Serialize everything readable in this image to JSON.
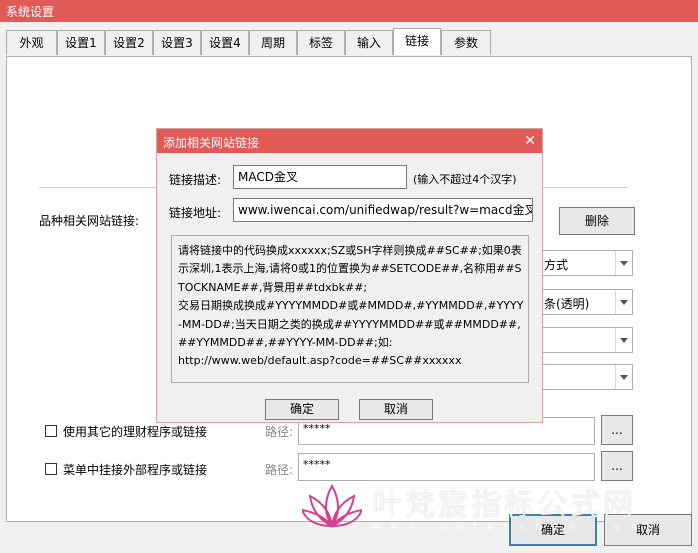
{
  "window": {
    "title": "系统设置",
    "accent": "#e05a58"
  },
  "tabs": [
    "外观",
    "设置1",
    "设置2",
    "设置3",
    "设置4",
    "周期",
    "标签",
    "输入",
    "链接",
    "参数"
  ],
  "active_tab": "链接",
  "panel": {
    "site_link_label": "品种相关网站链接:",
    "delete_button": "删除",
    "combo1": "方式",
    "combo2": "条(透明)",
    "combo3": "",
    "combo4": "",
    "other_finance": {
      "label": "使用其它的理财程序或链接",
      "path_label": "路径:",
      "path_value": "*****",
      "browse": "..."
    },
    "menu_external": {
      "label": "菜单中挂接外部程序或链接",
      "path_label": "路径:",
      "path_value": "*****",
      "browse": "..."
    }
  },
  "footer": {
    "ok": "确定",
    "cancel": "取消"
  },
  "dialog": {
    "title": "添加相关网站链接",
    "close_glyph": "✕",
    "desc_label": "链接描述:",
    "desc_value": "MACD金叉",
    "desc_hint": "(输入不超过4个汉字)",
    "url_label": "链接地址:",
    "url_value": "www.iwencai.com/unifiedwap/result?w=macd金叉的",
    "help_text": "请将链接中的代码换成xxxxxx;SZ或SH字样则换成##SC##;如果0表示深圳,1表示上海,请将0或1的位置换为##SETCODE##,名称用##STOCKNAME##,背景用##tdxbk##;\n交易日期换成换成#YYYYMMDD#或#MMDD#,#YYMMDD#,#YYYY-MM-DD#;当天日期之类的换成##YYYYMMDD##或##MMDD##,##YYMMDD##,##YYYY-MM-DD##;如:\nhttp://www.web/default.asp?code=##SC##xxxxxx",
    "ok": "确定",
    "cancel": "取消"
  },
  "watermark": {
    "text": "叶梵宸指标公式网",
    "url": "w w w . y e f a n c h e n . c o m"
  }
}
